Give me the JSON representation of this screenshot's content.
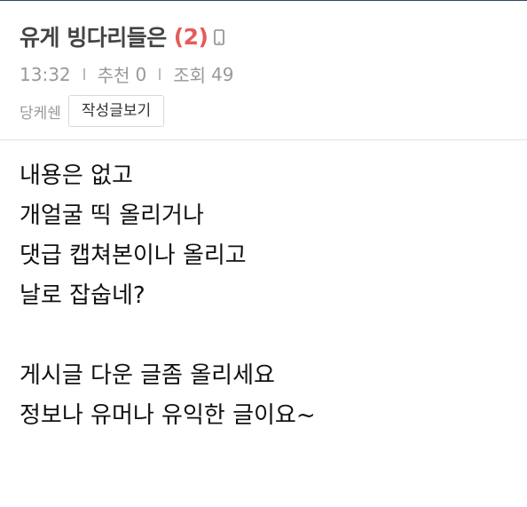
{
  "post": {
    "title": "유게 빙다리들은",
    "comment_count": "(2)",
    "device_icon": "mobile-icon",
    "time": "13:32",
    "recommend_label": "추천",
    "recommend_count": "0",
    "views_label": "조회",
    "views_count": "49",
    "author": "당케쉔",
    "author_posts_button": "작성글보기",
    "body_lines": [
      "내용은 없고",
      "개얼굴 띡 올리거나",
      "댓급 캡쳐본이나 올리고",
      "날로 잡숩네?",
      "",
      "게시글 다운 글좀 올리세요",
      "정보나 유머나 유익한 글이요~"
    ]
  },
  "colors": {
    "title": "#444444",
    "comment_count": "#e45c5c",
    "meta": "#999999",
    "top_border": "#33465c"
  }
}
